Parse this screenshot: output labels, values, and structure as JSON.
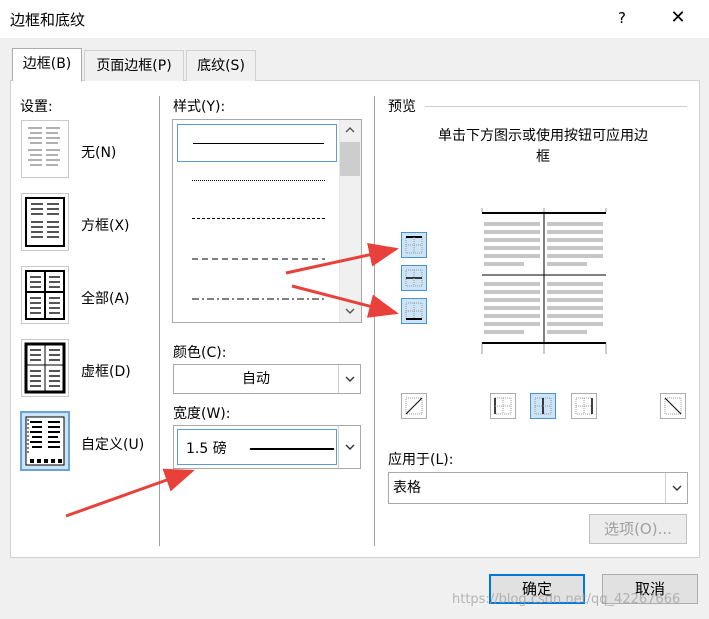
{
  "dialog": {
    "title": "边框和底纹",
    "help_label": "?",
    "close_label": "✕"
  },
  "tabs": [
    {
      "label": "边框(B)"
    },
    {
      "label": "页面边框(P)"
    },
    {
      "label": "底纹(S)"
    }
  ],
  "setting": {
    "heading": "设置:",
    "items": [
      {
        "label": "无(N)",
        "icon": "setting-none-icon"
      },
      {
        "label": "方框(X)",
        "icon": "setting-box-icon"
      },
      {
        "label": "全部(A)",
        "icon": "setting-all-icon"
      },
      {
        "label": "虚框(D)",
        "icon": "setting-grid-icon"
      },
      {
        "label": "自定义(U)",
        "icon": "setting-custom-icon",
        "selected": true
      }
    ]
  },
  "style": {
    "label": "样式(Y):",
    "options": [
      "solid",
      "dotted",
      "dashed-fine",
      "dashed",
      "dash-dot"
    ]
  },
  "color": {
    "label": "颜色(C):",
    "value": "自动"
  },
  "width": {
    "label": "宽度(W):",
    "value": "1.5 磅"
  },
  "preview": {
    "heading": "预览",
    "instruction": "单击下方图示或使用按钮可应用边框",
    "buttons": [
      "top-border-icon",
      "inside-horizontal-border-icon",
      "bottom-border-icon",
      "diagonal-down-icon",
      "left-border-icon",
      "inside-vertical-border-icon",
      "right-border-icon",
      "diagonal-up-icon"
    ]
  },
  "apply_to": {
    "label": "应用于(L):",
    "value": "表格"
  },
  "options_button": "选项(O)...",
  "ok_button": "确定",
  "cancel_button": "取消",
  "watermark": "https://blog.csdn.net/qq_42267666",
  "colors": {
    "accent": "#0078d7",
    "arrow": "#e8413b",
    "selected_bg": "#cce4f7"
  }
}
